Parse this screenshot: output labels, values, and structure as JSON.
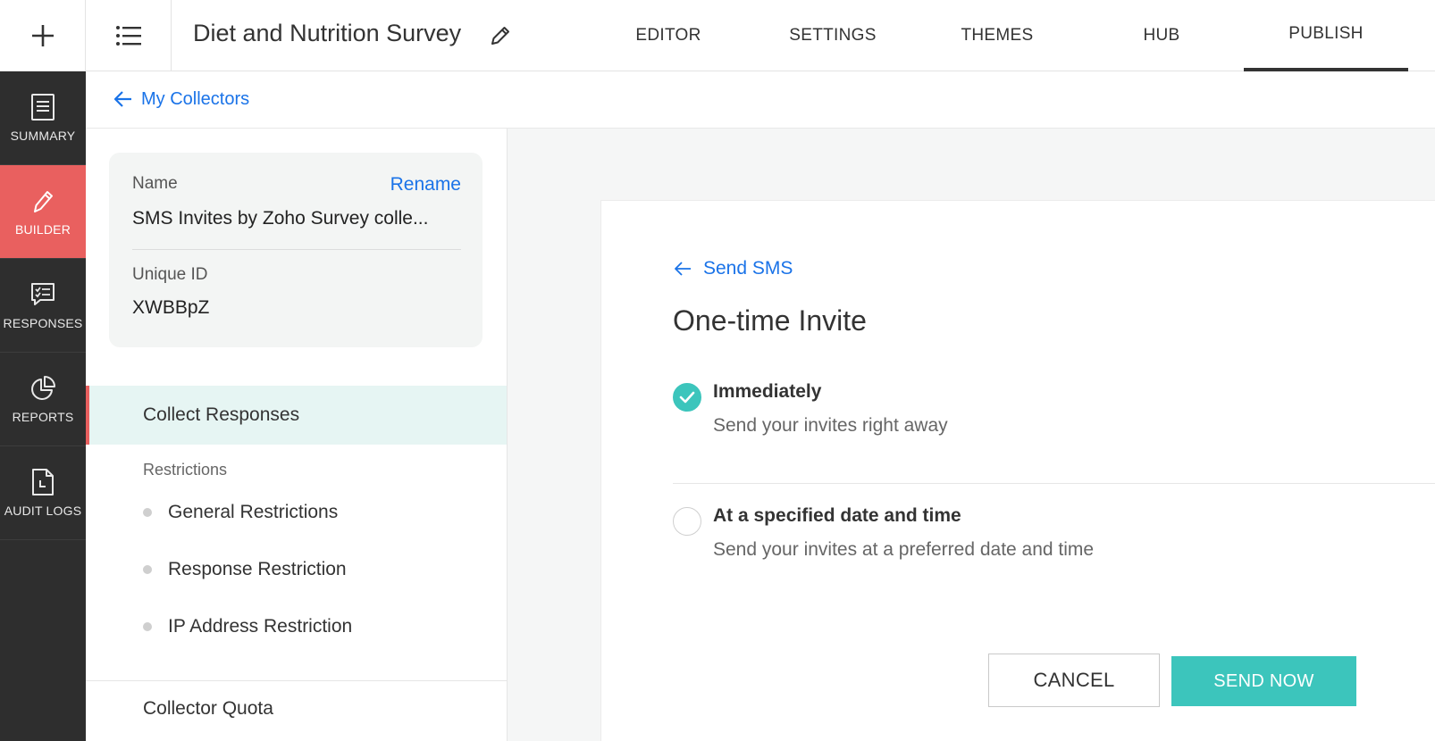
{
  "header": {
    "survey_title": "Diet and Nutrition Survey",
    "tabs": [
      {
        "label": "EDITOR"
      },
      {
        "label": "SETTINGS"
      },
      {
        "label": "THEMES"
      },
      {
        "label": "HUB"
      },
      {
        "label": "PUBLISH",
        "active": true
      }
    ],
    "icons": {
      "add": "plus-icon",
      "menu": "list-icon",
      "edit": "pencil-icon"
    }
  },
  "sidebar": {
    "items": [
      {
        "label": "SUMMARY",
        "icon": "document-icon"
      },
      {
        "label": "BUILDER",
        "icon": "pencil-icon",
        "active": true
      },
      {
        "label": "RESPONSES",
        "icon": "responses-icon"
      },
      {
        "label": "REPORTS",
        "icon": "pie-chart-icon"
      },
      {
        "label": "AUDIT LOGS",
        "icon": "audit-log-icon"
      }
    ],
    "active_color": "#e9605f"
  },
  "breadcrumb": {
    "label": "My Collectors"
  },
  "collector": {
    "name_label": "Name",
    "rename_label": "Rename",
    "name_value": "SMS Invites by Zoho Survey colle...",
    "id_label": "Unique ID",
    "id_value": "XWBBpZ"
  },
  "settings_nav": {
    "active_section": "Collect Responses",
    "sub_heading": "Restrictions",
    "restrictions": [
      "General Restrictions",
      "Response Restriction",
      "IP Address Restriction"
    ],
    "next_section": "Collector Quota"
  },
  "invite": {
    "back_label": "Send SMS",
    "title": "One-time Invite",
    "options": [
      {
        "title": "Immediately",
        "description": "Send your invites right away",
        "selected": true
      },
      {
        "title": "At a specified date and time",
        "description": "Send your invites at a preferred date and time",
        "selected": false
      }
    ],
    "cancel_label": "CANCEL",
    "send_label": "SEND NOW",
    "accent_color": "#3cc5bc",
    "link_color": "#1a73e8"
  }
}
